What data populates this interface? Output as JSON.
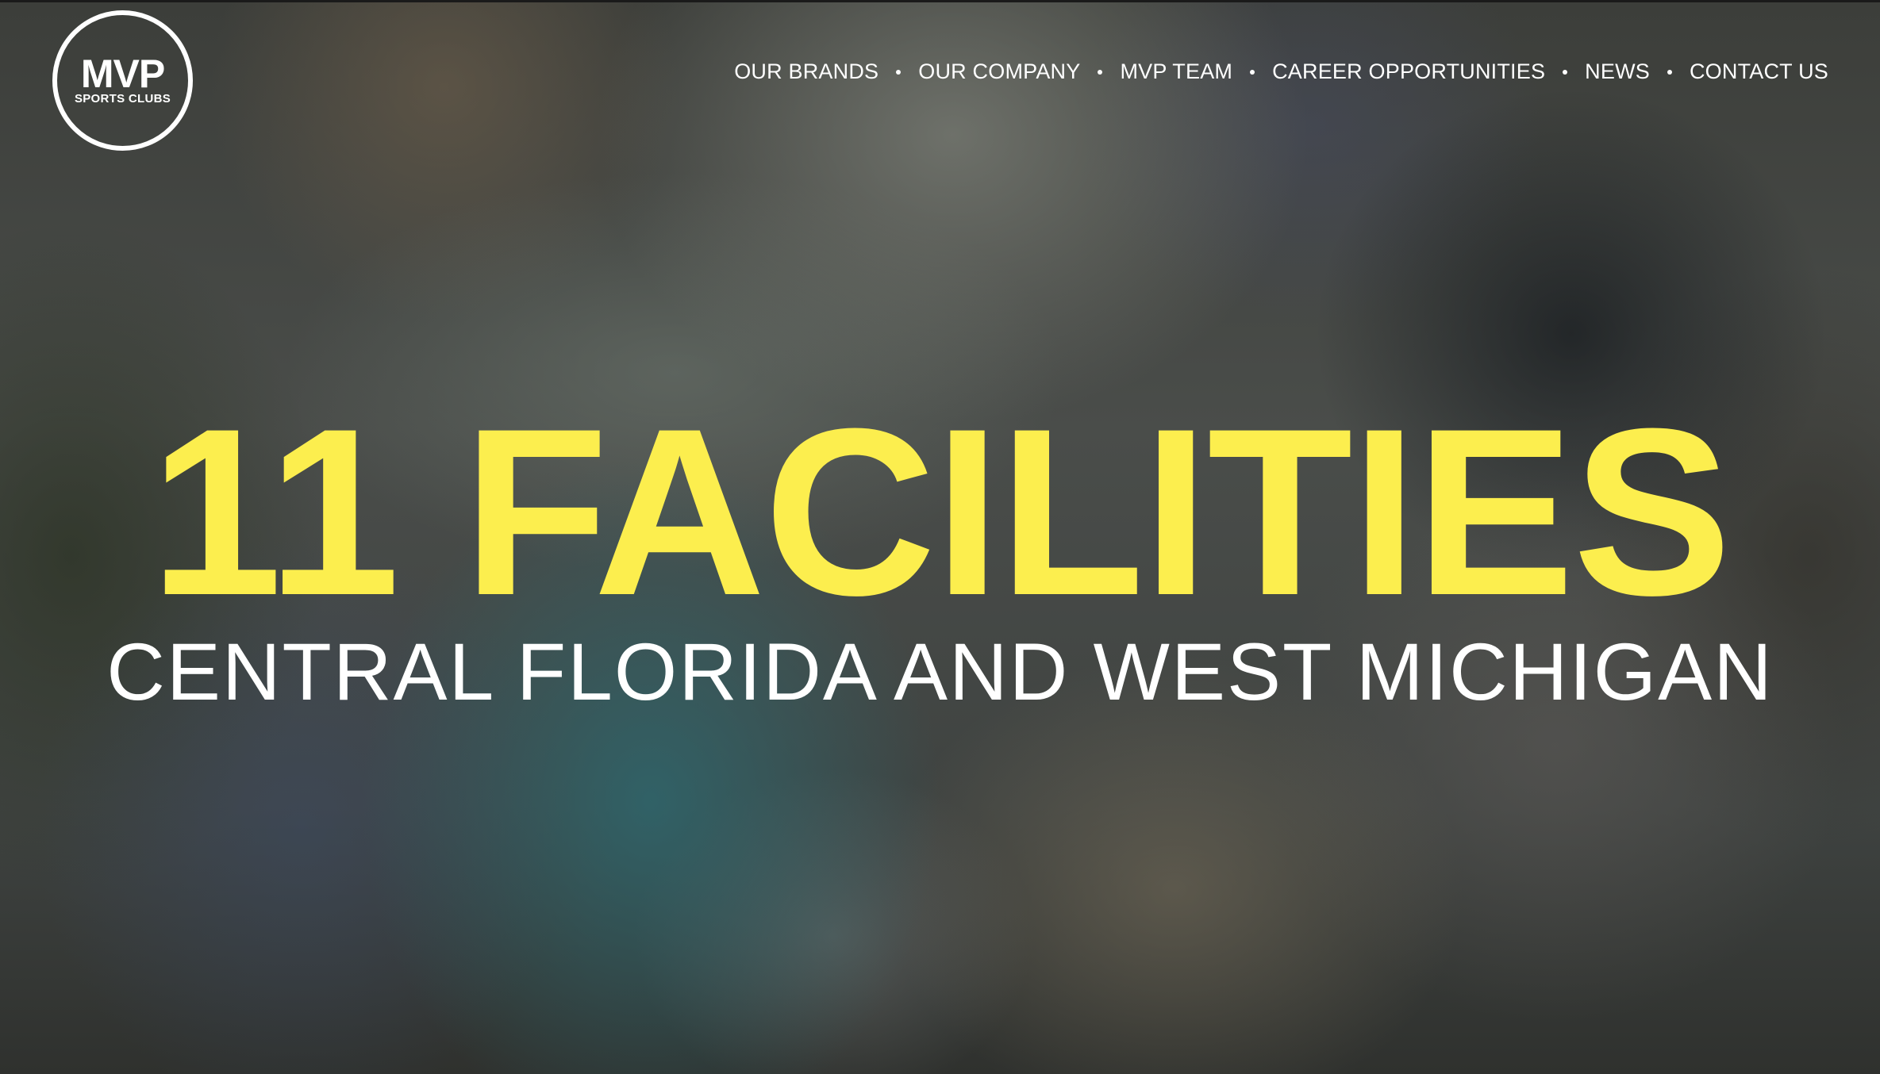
{
  "brand": {
    "logo_main": "MVP",
    "logo_sub": "SPORTS CLUBS"
  },
  "nav": {
    "items": [
      {
        "label": "OUR BRANDS"
      },
      {
        "label": "OUR COMPANY"
      },
      {
        "label": "MVP TEAM"
      },
      {
        "label": "CAREER OPPORTUNITIES"
      },
      {
        "label": "NEWS"
      },
      {
        "label": "CONTACT US"
      }
    ]
  },
  "hero": {
    "headline": "11 FACILITIES",
    "subheadline": "CENTRAL FLORIDA AND WEST MICHIGAN"
  },
  "colors": {
    "headline": "#fcee4e",
    "text": "#ffffff"
  }
}
